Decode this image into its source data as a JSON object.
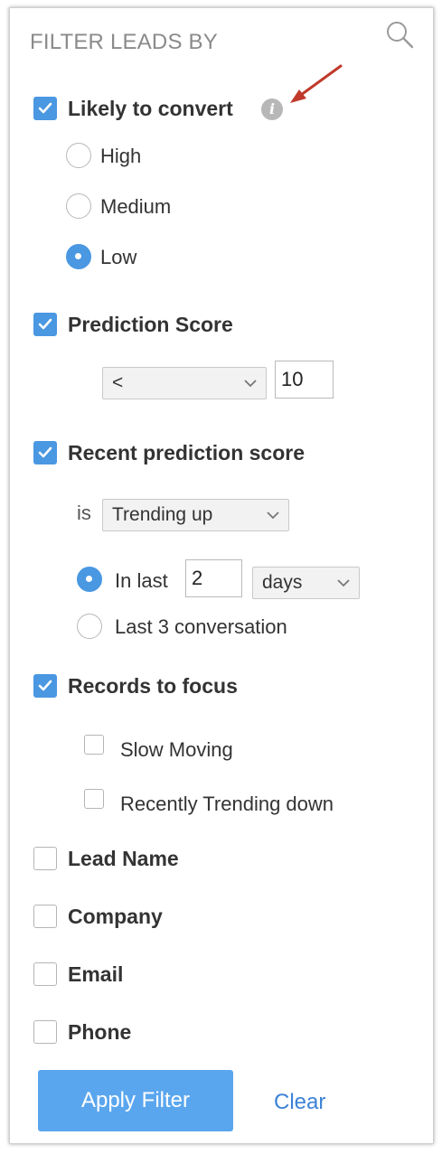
{
  "panel": {
    "title": "FILTER LEADS BY",
    "search_icon": "search-icon"
  },
  "likely_to_convert": {
    "label": "Likely to convert",
    "checked": true,
    "info_icon": "i",
    "options": [
      {
        "label": "High",
        "selected": false
      },
      {
        "label": "Medium",
        "selected": false
      },
      {
        "label": "Low",
        "selected": true
      }
    ]
  },
  "prediction_score": {
    "label": "Prediction Score",
    "checked": true,
    "operator": "<",
    "value": "10"
  },
  "recent_prediction_score": {
    "label": "Recent prediction score",
    "checked": true,
    "is_label": "is",
    "trend": "Trending up",
    "in_last_label": "In last",
    "in_last_selected": true,
    "in_last_value": "2",
    "in_last_unit": "days",
    "last_conversation_label": "Last 3 conversation",
    "last_conversation_selected": false
  },
  "records_to_focus": {
    "label": "Records to focus",
    "checked": true,
    "options": [
      {
        "label": "Slow Moving",
        "checked": false
      },
      {
        "label": "Recently Trending down",
        "checked": false
      }
    ]
  },
  "fields": [
    {
      "label": "Lead Name",
      "checked": false
    },
    {
      "label": "Company",
      "checked": false
    },
    {
      "label": "Email",
      "checked": false
    },
    {
      "label": "Phone",
      "checked": false
    }
  ],
  "actions": {
    "apply_label": "Apply Filter",
    "clear_label": "Clear"
  },
  "colors": {
    "accent": "#4a97e2",
    "button": "#5aa6ee",
    "link": "#3b82d6",
    "arrow": "#c0392b"
  }
}
